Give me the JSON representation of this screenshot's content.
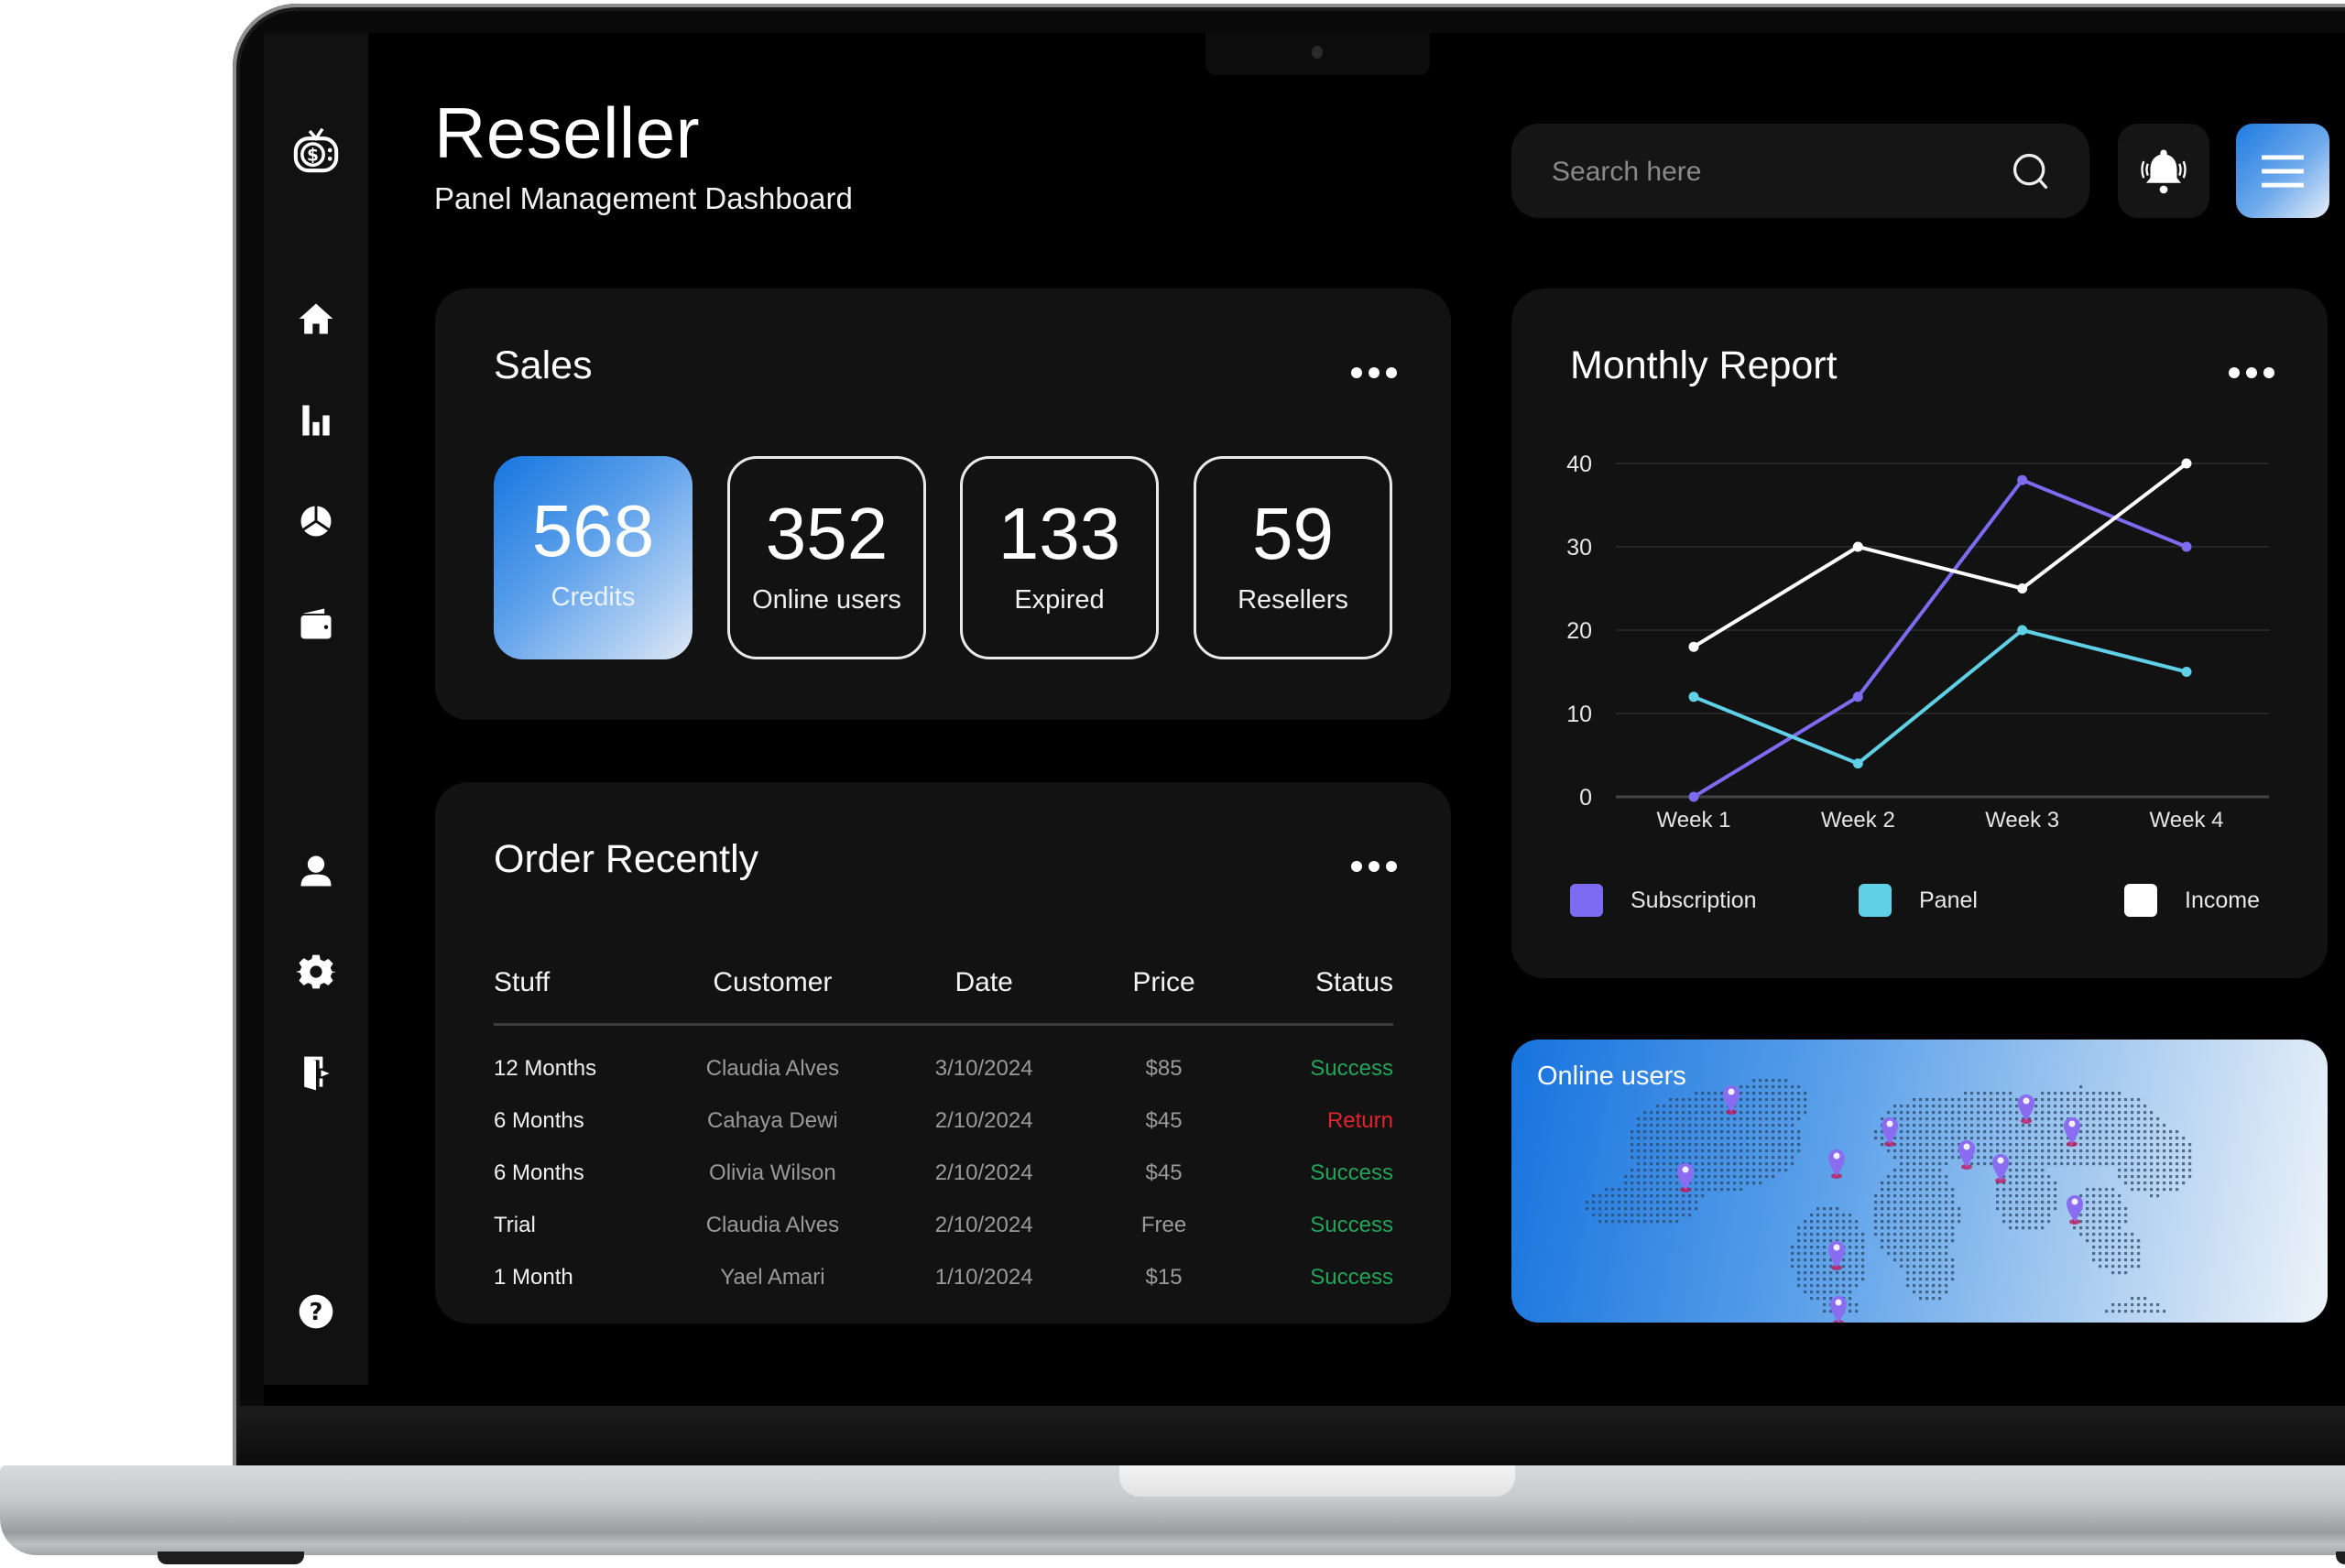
{
  "header": {
    "title": "Reseller",
    "subtitle": "Panel Management Dashboard",
    "search": {
      "placeholder": "Search here",
      "value": ""
    },
    "icons": {
      "search": "search-icon",
      "notifications": "bell-ringing-icon",
      "menu": "hamburger-menu-icon"
    }
  },
  "sidebar": {
    "logo": "tv-dollar-logo-icon",
    "items": [
      {
        "name": "home",
        "icon": "home-icon"
      },
      {
        "name": "analytics",
        "icon": "bar-chart-icon"
      },
      {
        "name": "reports",
        "icon": "pie-chart-icon"
      },
      {
        "name": "wallet",
        "icon": "wallet-icon"
      },
      {
        "name": "profile",
        "icon": "user-icon"
      },
      {
        "name": "settings",
        "icon": "gear-icon"
      },
      {
        "name": "logout",
        "icon": "logout-icon"
      },
      {
        "name": "help",
        "icon": "help-icon"
      }
    ]
  },
  "sales": {
    "title": "Sales",
    "stats": [
      {
        "value": "568",
        "label": "Credits"
      },
      {
        "value": "352",
        "label": "Online users"
      },
      {
        "value": "133",
        "label": "Expired"
      },
      {
        "value": "59",
        "label": "Resellers"
      }
    ]
  },
  "orders": {
    "title": "Order Recently",
    "columns": [
      "Stuff",
      "Customer",
      "Date",
      "Price",
      "Status"
    ],
    "rows": [
      {
        "stuff": "12 Months",
        "customer": "Claudia Alves",
        "date": "3/10/2024",
        "price": "$85",
        "status": "Success"
      },
      {
        "stuff": "6 Months",
        "customer": "Cahaya Dewi",
        "date": "2/10/2024",
        "price": "$45",
        "status": "Return"
      },
      {
        "stuff": "6 Months",
        "customer": "Olivia Wilson",
        "date": "2/10/2024",
        "price": "$45",
        "status": "Success"
      },
      {
        "stuff": "Trial",
        "customer": "Claudia Alves",
        "date": "2/10/2024",
        "price": "Free",
        "status": "Success"
      },
      {
        "stuff": "1 Month",
        "customer": "Yael Amari",
        "date": "1/10/2024",
        "price": "$15",
        "status": "Success"
      }
    ],
    "status_colors": {
      "Success": "#22a55a",
      "Return": "#e0242c"
    }
  },
  "monthly_report": {
    "title": "Monthly Report"
  },
  "chart_data": {
    "type": "line",
    "title": "Monthly Report",
    "xlabel": "",
    "ylabel": "",
    "categories": [
      "Week 1",
      "Week 2",
      "Week 3",
      "Week 4"
    ],
    "ylim": [
      0,
      40
    ],
    "yticks": [
      0,
      10,
      20,
      30,
      40
    ],
    "grid": true,
    "legend_position": "bottom",
    "series": [
      {
        "name": "Subscription",
        "color": "#7d6cf2",
        "values": [
          0,
          12,
          38,
          30
        ]
      },
      {
        "name": "Panel",
        "color": "#5fd0e6",
        "values": [
          12,
          4,
          20,
          15
        ]
      },
      {
        "name": "Income",
        "color": "#ffffff",
        "values": [
          18,
          30,
          25,
          40
        ]
      }
    ]
  },
  "online_map": {
    "title": "Online users",
    "pins": 11
  },
  "colors": {
    "accent_blue": "#1676e0",
    "card_bg": "#121212",
    "success": "#22a55a",
    "return": "#e0242c"
  }
}
